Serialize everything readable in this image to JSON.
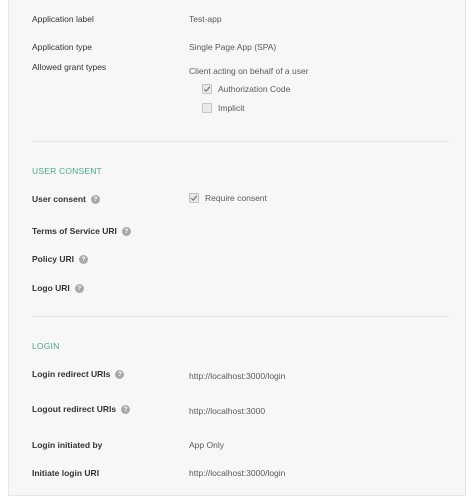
{
  "general": {
    "app_label": {
      "label": "Application label",
      "value": "Test-app"
    },
    "app_type": {
      "label": "Application type",
      "value": "Single Page App (SPA)"
    },
    "grant_types": {
      "label": "Allowed grant types",
      "description": "Client acting on behalf of a user",
      "options": [
        {
          "label": "Authorization Code",
          "checked": true
        },
        {
          "label": "Implicit",
          "checked": false
        }
      ]
    }
  },
  "user_consent": {
    "section_title": "USER CONSENT",
    "consent": {
      "label": "User consent",
      "checkbox_label": "Require consent",
      "checked": true
    },
    "tos_uri": {
      "label": "Terms of Service URI"
    },
    "policy_uri": {
      "label": "Policy URI"
    },
    "logo_uri": {
      "label": "Logo URI"
    },
    "help_glyph": "?"
  },
  "login": {
    "section_title": "LOGIN",
    "redirect_uris": {
      "label": "Login redirect URIs",
      "value": "http://localhost:3000/login"
    },
    "logout_uris": {
      "label": "Logout redirect URIs",
      "value": "http://localhost:3000"
    },
    "initiated_by": {
      "label": "Login initiated by",
      "value": "App Only"
    },
    "initiate_uri": {
      "label": "Initiate login URI",
      "value": "http://localhost:3000/login"
    }
  },
  "colors": {
    "accent": "#4aa88a",
    "panel_bg": "#f7f7f7"
  }
}
